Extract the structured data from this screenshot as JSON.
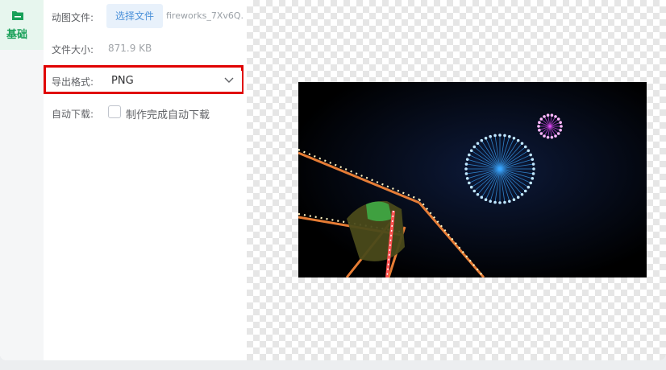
{
  "nav": {
    "items": [
      {
        "label": "基础",
        "icon": "folder-icon",
        "active": true
      }
    ]
  },
  "settings": {
    "anim_file_label": "动图文件:",
    "choose_file_label": "选择文件",
    "file_name": "fireworks_7Xv6Q...",
    "file_size_label": "文件大小:",
    "file_size_value": "871.9 KB",
    "export_format_label": "导出格式:",
    "export_format_value": "PNG",
    "auto_download_label": "自动下载:",
    "auto_download_option": "制作完成自动下载",
    "auto_download_checked": false
  },
  "colors": {
    "accent_green": "#18a058",
    "highlight_red": "#e00000",
    "button_blue": "#4a90d9"
  },
  "preview": {
    "image": "fireworks-ferris-wheel-image"
  }
}
